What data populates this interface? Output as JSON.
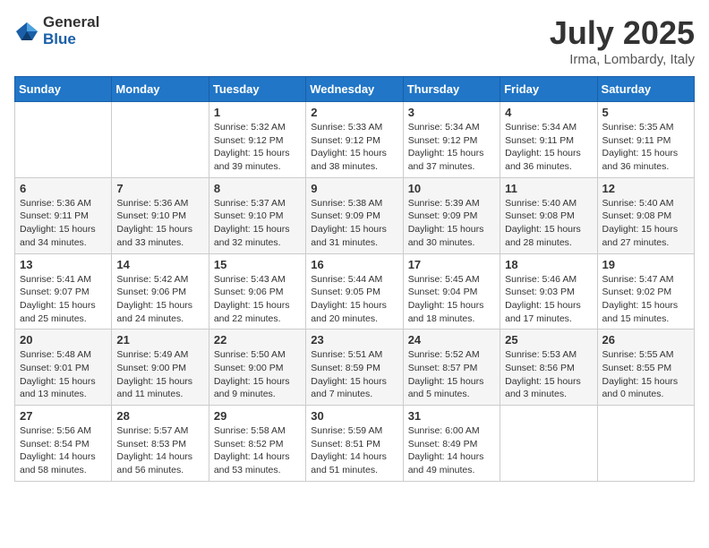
{
  "header": {
    "logo_general": "General",
    "logo_blue": "Blue",
    "month_title": "July 2025",
    "location": "Irma, Lombardy, Italy"
  },
  "weekdays": [
    "Sunday",
    "Monday",
    "Tuesday",
    "Wednesday",
    "Thursday",
    "Friday",
    "Saturday"
  ],
  "weeks": [
    [
      {
        "day": "",
        "detail": ""
      },
      {
        "day": "",
        "detail": ""
      },
      {
        "day": "1",
        "detail": "Sunrise: 5:32 AM\nSunset: 9:12 PM\nDaylight: 15 hours\nand 39 minutes."
      },
      {
        "day": "2",
        "detail": "Sunrise: 5:33 AM\nSunset: 9:12 PM\nDaylight: 15 hours\nand 38 minutes."
      },
      {
        "day": "3",
        "detail": "Sunrise: 5:34 AM\nSunset: 9:12 PM\nDaylight: 15 hours\nand 37 minutes."
      },
      {
        "day": "4",
        "detail": "Sunrise: 5:34 AM\nSunset: 9:11 PM\nDaylight: 15 hours\nand 36 minutes."
      },
      {
        "day": "5",
        "detail": "Sunrise: 5:35 AM\nSunset: 9:11 PM\nDaylight: 15 hours\nand 36 minutes."
      }
    ],
    [
      {
        "day": "6",
        "detail": "Sunrise: 5:36 AM\nSunset: 9:11 PM\nDaylight: 15 hours\nand 34 minutes."
      },
      {
        "day": "7",
        "detail": "Sunrise: 5:36 AM\nSunset: 9:10 PM\nDaylight: 15 hours\nand 33 minutes."
      },
      {
        "day": "8",
        "detail": "Sunrise: 5:37 AM\nSunset: 9:10 PM\nDaylight: 15 hours\nand 32 minutes."
      },
      {
        "day": "9",
        "detail": "Sunrise: 5:38 AM\nSunset: 9:09 PM\nDaylight: 15 hours\nand 31 minutes."
      },
      {
        "day": "10",
        "detail": "Sunrise: 5:39 AM\nSunset: 9:09 PM\nDaylight: 15 hours\nand 30 minutes."
      },
      {
        "day": "11",
        "detail": "Sunrise: 5:40 AM\nSunset: 9:08 PM\nDaylight: 15 hours\nand 28 minutes."
      },
      {
        "day": "12",
        "detail": "Sunrise: 5:40 AM\nSunset: 9:08 PM\nDaylight: 15 hours\nand 27 minutes."
      }
    ],
    [
      {
        "day": "13",
        "detail": "Sunrise: 5:41 AM\nSunset: 9:07 PM\nDaylight: 15 hours\nand 25 minutes."
      },
      {
        "day": "14",
        "detail": "Sunrise: 5:42 AM\nSunset: 9:06 PM\nDaylight: 15 hours\nand 24 minutes."
      },
      {
        "day": "15",
        "detail": "Sunrise: 5:43 AM\nSunset: 9:06 PM\nDaylight: 15 hours\nand 22 minutes."
      },
      {
        "day": "16",
        "detail": "Sunrise: 5:44 AM\nSunset: 9:05 PM\nDaylight: 15 hours\nand 20 minutes."
      },
      {
        "day": "17",
        "detail": "Sunrise: 5:45 AM\nSunset: 9:04 PM\nDaylight: 15 hours\nand 18 minutes."
      },
      {
        "day": "18",
        "detail": "Sunrise: 5:46 AM\nSunset: 9:03 PM\nDaylight: 15 hours\nand 17 minutes."
      },
      {
        "day": "19",
        "detail": "Sunrise: 5:47 AM\nSunset: 9:02 PM\nDaylight: 15 hours\nand 15 minutes."
      }
    ],
    [
      {
        "day": "20",
        "detail": "Sunrise: 5:48 AM\nSunset: 9:01 PM\nDaylight: 15 hours\nand 13 minutes."
      },
      {
        "day": "21",
        "detail": "Sunrise: 5:49 AM\nSunset: 9:00 PM\nDaylight: 15 hours\nand 11 minutes."
      },
      {
        "day": "22",
        "detail": "Sunrise: 5:50 AM\nSunset: 9:00 PM\nDaylight: 15 hours\nand 9 minutes."
      },
      {
        "day": "23",
        "detail": "Sunrise: 5:51 AM\nSunset: 8:59 PM\nDaylight: 15 hours\nand 7 minutes."
      },
      {
        "day": "24",
        "detail": "Sunrise: 5:52 AM\nSunset: 8:57 PM\nDaylight: 15 hours\nand 5 minutes."
      },
      {
        "day": "25",
        "detail": "Sunrise: 5:53 AM\nSunset: 8:56 PM\nDaylight: 15 hours\nand 3 minutes."
      },
      {
        "day": "26",
        "detail": "Sunrise: 5:55 AM\nSunset: 8:55 PM\nDaylight: 15 hours\nand 0 minutes."
      }
    ],
    [
      {
        "day": "27",
        "detail": "Sunrise: 5:56 AM\nSunset: 8:54 PM\nDaylight: 14 hours\nand 58 minutes."
      },
      {
        "day": "28",
        "detail": "Sunrise: 5:57 AM\nSunset: 8:53 PM\nDaylight: 14 hours\nand 56 minutes."
      },
      {
        "day": "29",
        "detail": "Sunrise: 5:58 AM\nSunset: 8:52 PM\nDaylight: 14 hours\nand 53 minutes."
      },
      {
        "day": "30",
        "detail": "Sunrise: 5:59 AM\nSunset: 8:51 PM\nDaylight: 14 hours\nand 51 minutes."
      },
      {
        "day": "31",
        "detail": "Sunrise: 6:00 AM\nSunset: 8:49 PM\nDaylight: 14 hours\nand 49 minutes."
      },
      {
        "day": "",
        "detail": ""
      },
      {
        "day": "",
        "detail": ""
      }
    ]
  ]
}
